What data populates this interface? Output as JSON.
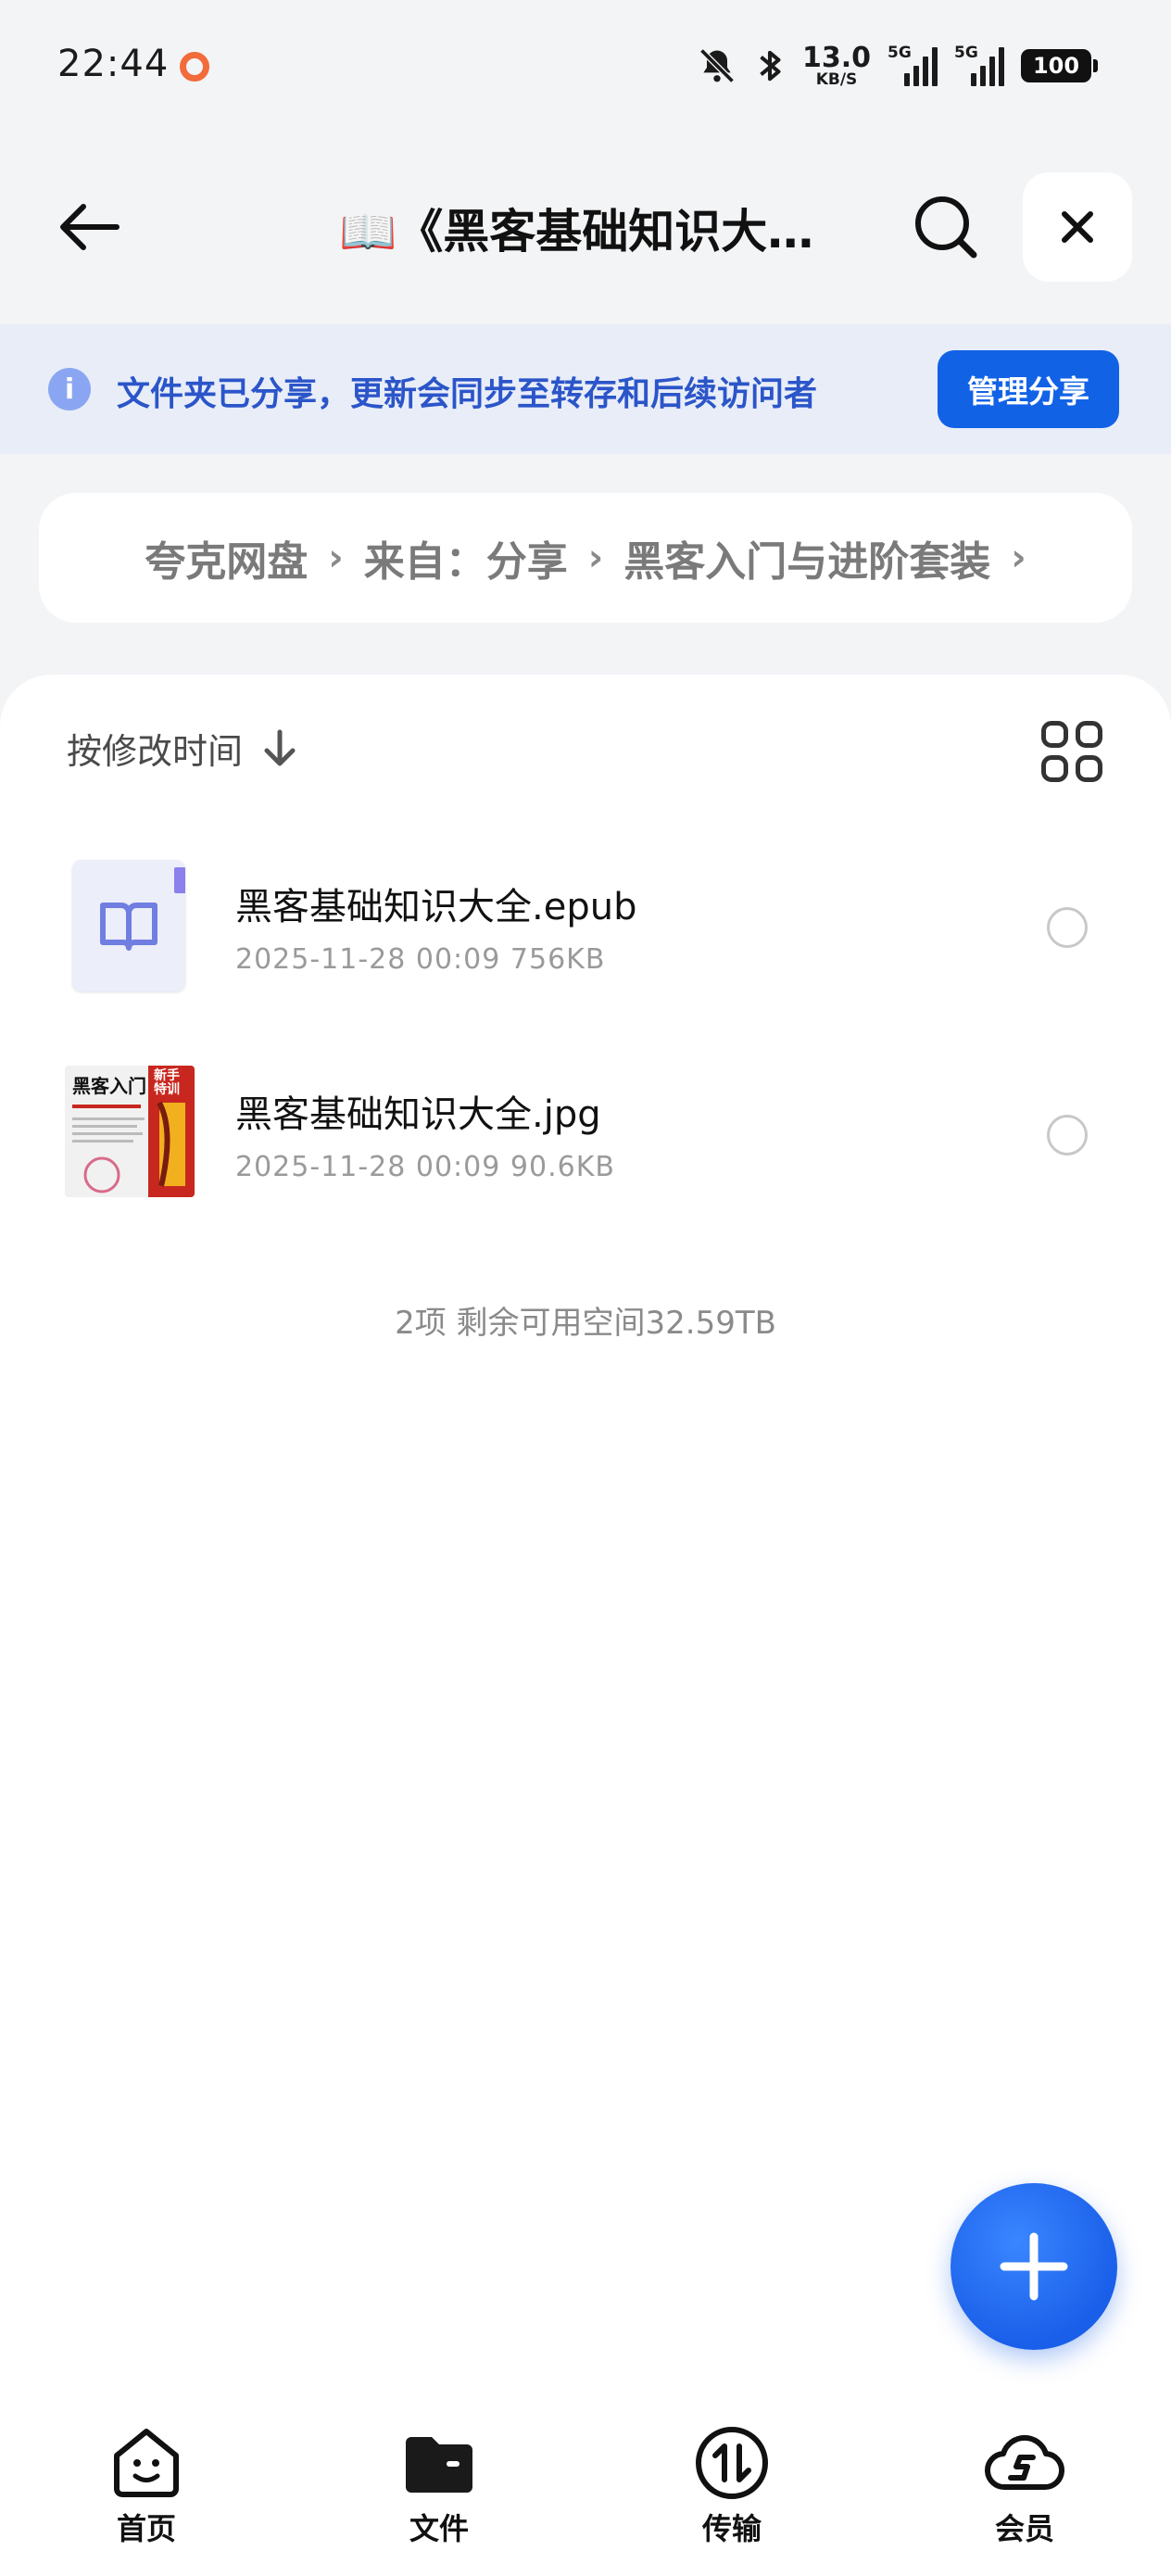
{
  "status_bar": {
    "time": "22:44",
    "net_speed_value": "13.0",
    "net_speed_unit": "KB/S",
    "signal1_label": "5G",
    "signal2_label": "5G",
    "battery": "100"
  },
  "header": {
    "title": "📖《黑客基础知识大全》"
  },
  "banner": {
    "text": "文件夹已分享，更新会同步至转存和后续访问者",
    "manage_button": "管理分享"
  },
  "breadcrumb": [
    "夸克网盘",
    "来自：分享",
    "黑客入门与进阶套装"
  ],
  "list": {
    "sort_label": "按修改时间",
    "files": [
      {
        "name": "黑客基础知识大全.epub",
        "date": "2025-11-28 00:09",
        "size": "756KB",
        "type": "epub"
      },
      {
        "name": "黑客基础知识大全.jpg",
        "date": "2025-11-28 00:09",
        "size": "90.6KB",
        "type": "image"
      }
    ],
    "summary": "2项 剩余可用空间32.59TB"
  },
  "thumb_text": {
    "cover_title": "黑客入门",
    "cover_badge": "新手特训"
  },
  "bottom_nav": [
    {
      "label": "首页",
      "icon": "home-face-icon"
    },
    {
      "label": "文件",
      "icon": "folder-icon"
    },
    {
      "label": "传输",
      "icon": "transfer-icon"
    },
    {
      "label": "会员",
      "icon": "cloud-vip-icon"
    }
  ],
  "colors": {
    "accent": "#1262e6",
    "banner_bg": "#e8edf8",
    "banner_text": "#2b55c9"
  }
}
